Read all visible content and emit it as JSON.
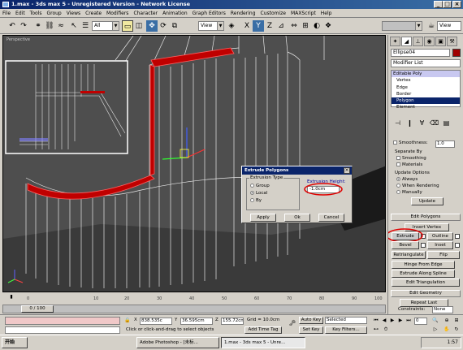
{
  "window": {
    "title": "1.max - 3ds max 5 - Unregistered Version - Network License",
    "controls": [
      "_",
      "□",
      "×"
    ]
  },
  "menu": [
    "File",
    "Edit",
    "Tools",
    "Group",
    "Views",
    "Create",
    "Modifiers",
    "Character",
    "Animation",
    "Graph Editors",
    "Rendering",
    "Customize",
    "MAXScript",
    "Help"
  ],
  "toolbar": {
    "selection_filter": "All",
    "reference_coord": "View",
    "axis_x": "X",
    "axis_y": "Y",
    "axis_z": "Z",
    "render_view": "View"
  },
  "viewport": {
    "label": "Perspective"
  },
  "dialog": {
    "title": "Extrude Polygons",
    "close": "×",
    "group_label": "Extrusion Type",
    "options": [
      "Group",
      "Local",
      "By"
    ],
    "selected_option": "Local",
    "height_label": "Extrusion Height:",
    "height_value": "-1.0cm",
    "buttons": [
      "Apply",
      "Ok",
      "Cancel"
    ]
  },
  "panel": {
    "object_name": "Ellipse04",
    "object_color": "#a00000",
    "modifier_list": "Modifier List",
    "stack": [
      "Editable Poly",
      "Vertex",
      "Edge",
      "Border",
      "Polygon",
      "Element"
    ],
    "stack_selected": "Polygon",
    "smoothness_label": "Smoothness:",
    "smoothness_value": "1.0",
    "separate_by": "Separate By",
    "smoothing": "Smoothing",
    "materials": "Materials",
    "update_options": "Update Options",
    "always": "Always",
    "when_rendering": "When Rendering",
    "manually": "Manually",
    "update_btn": "Update",
    "edit_polygons": "Edit Polygons",
    "insert_vertex": "Insert Vertex",
    "extrude": "Extrude",
    "outline": "Outline",
    "bevel": "Bevel",
    "inset": "Inset",
    "retriangulate": "Retriangulate",
    "flip": "Flip",
    "hinge": "Hinge From Edge",
    "extrude_spline": "Extrude Along Spline",
    "edit_triangulation": "Edit Triangulation",
    "edit_geometry": "Edit Geometry",
    "repeat_last": "Repeat Last",
    "constraints": "Constraints:",
    "constraints_value": "None"
  },
  "timeline": {
    "slider": "0 / 100",
    "ticks": [
      "0",
      "10",
      "20",
      "30",
      "40",
      "50",
      "60",
      "70",
      "80",
      "90",
      "100"
    ]
  },
  "status": {
    "x_label": "X",
    "x_value": "838.535c",
    "y_label": "Y",
    "y_value": "36.595cm",
    "z_label": "Z",
    "z_value": "155.72cm",
    "grid": "Grid = 10.0cm",
    "prompt": "Click or click-and-drag to select objects",
    "add_time_tag": "Add Time Tag",
    "auto_key": "Auto Key",
    "auto_key_sel": "Selected",
    "set_key": "Set Key",
    "key_filters": "Key Filters...",
    "frame": "0"
  },
  "taskbar": {
    "start": "开始",
    "tasks": [
      "Adobe Photoshop - [未标...",
      "1.max - 3ds max 5 - Unre..."
    ],
    "active_task": 1,
    "clock": "1:57"
  }
}
